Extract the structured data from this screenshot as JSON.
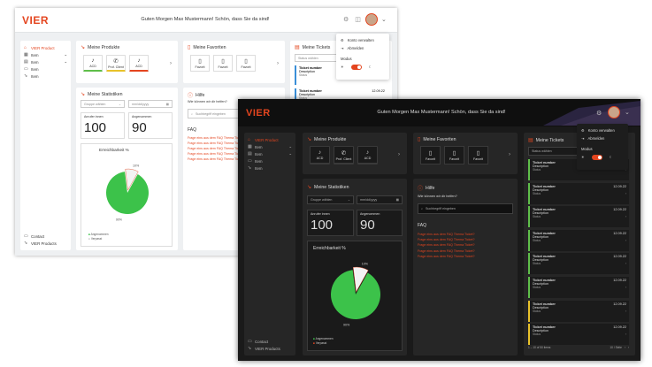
{
  "brand": {
    "logo": "VIER",
    "accent": "#e4451f",
    "green": "#5fbf4a",
    "yellow": "#e8c22a",
    "blue": "#3a8fd8"
  },
  "header": {
    "greeting": "Guten Morgen Max Mustermann! Schön, dass Sie da sind!"
  },
  "sidebar": {
    "items": [
      {
        "label": "VIER Product",
        "icon": "home-icon",
        "active": true
      },
      {
        "label": "Item",
        "icon": "calendar-icon"
      },
      {
        "label": "Item",
        "icon": "grid-icon"
      },
      {
        "label": "Item",
        "icon": "chat-icon"
      },
      {
        "label": "Item",
        "icon": "pointer-icon"
      }
    ],
    "bottom": [
      {
        "label": "Contact",
        "icon": "chat-icon"
      },
      {
        "label": "VIER Products",
        "icon": "pointer-icon"
      }
    ]
  },
  "products": {
    "title": "Meine Produkte",
    "items": [
      {
        "label": "ACD",
        "color": "#5fbf4a"
      },
      {
        "label": "Prof. Client",
        "color": "#e8c22a"
      },
      {
        "label": "ACD",
        "color": "#e4451f"
      }
    ]
  },
  "favorites": {
    "title": "Meine Favoriten",
    "items": [
      "Favorit",
      "Favorit",
      "Favorit"
    ]
  },
  "tickets": {
    "title": "Meine Tickets",
    "filter_placeholder": "Status wählen",
    "items": [
      {
        "number": "Ticket number",
        "date": "12.09.22",
        "description": "Description",
        "status": "Status"
      },
      {
        "number": "Ticket number",
        "date": "12.09.22",
        "description": "Description",
        "status": "Status"
      },
      {
        "number": "Ticket number",
        "date": "12.09.22",
        "description": "Description",
        "status": "Status"
      },
      {
        "number": "Ticket number",
        "date": "12.09.22",
        "description": "Description",
        "status": "Status"
      },
      {
        "number": "Ticket number",
        "date": "12.09.22",
        "description": "Description",
        "status": "Status"
      },
      {
        "number": "Ticket number",
        "date": "12.09.22",
        "description": "Description",
        "status": "Status"
      },
      {
        "number": "Ticket number",
        "date": "12.09.22",
        "description": "Description",
        "status": "Status"
      },
      {
        "number": "Ticket number",
        "date": "12.09.22",
        "description": "Description",
        "status": "Status"
      }
    ],
    "pagination": "1 – 10 of 50 items",
    "per_page": "10 / Seite"
  },
  "stats": {
    "title": "Meine Statistiken",
    "group_placeholder": "Gruppe wählen",
    "date_placeholder": "mm/dd/yyyy",
    "called_label": "Anrufer innen",
    "called_value": "100",
    "accepted_label": "Angenommen",
    "accepted_value": "90",
    "reach_title": "Erreichbarkeit %",
    "legend": [
      "Angenommen",
      "Verpasst"
    ]
  },
  "chart_data": {
    "type": "pie",
    "title": "Erreichbarkeit %",
    "categories": [
      "Angenommen",
      "Verpasst"
    ],
    "values": [
      90,
      10
    ],
    "labels": [
      "90%",
      "10%"
    ],
    "colors": [
      "#3cc24a",
      "#f3f3f3"
    ],
    "legend_position": "bottom-left"
  },
  "help": {
    "title": "Hilfe",
    "question": "Wie können wir dir helfen?",
    "search_placeholder": "Suchbegriff eingeben",
    "faq_title": "FAQ",
    "faq_items": [
      "Frage eins aus dem FAQ Thema Ticket?",
      "Frage eins aus dem FAQ Thema Ticket?",
      "Frage eins aus dem FAQ Thema Ticket?",
      "Frage eins aus dem FAQ Thema Ticket?",
      "Frage eins aus dem FAQ Thema Ticket?"
    ]
  },
  "menu": {
    "items": [
      {
        "label": "Konto verwalten",
        "icon": "gear-icon"
      },
      {
        "label": "Abmelden",
        "icon": "logout-icon"
      }
    ],
    "mode_label": "Modus"
  }
}
